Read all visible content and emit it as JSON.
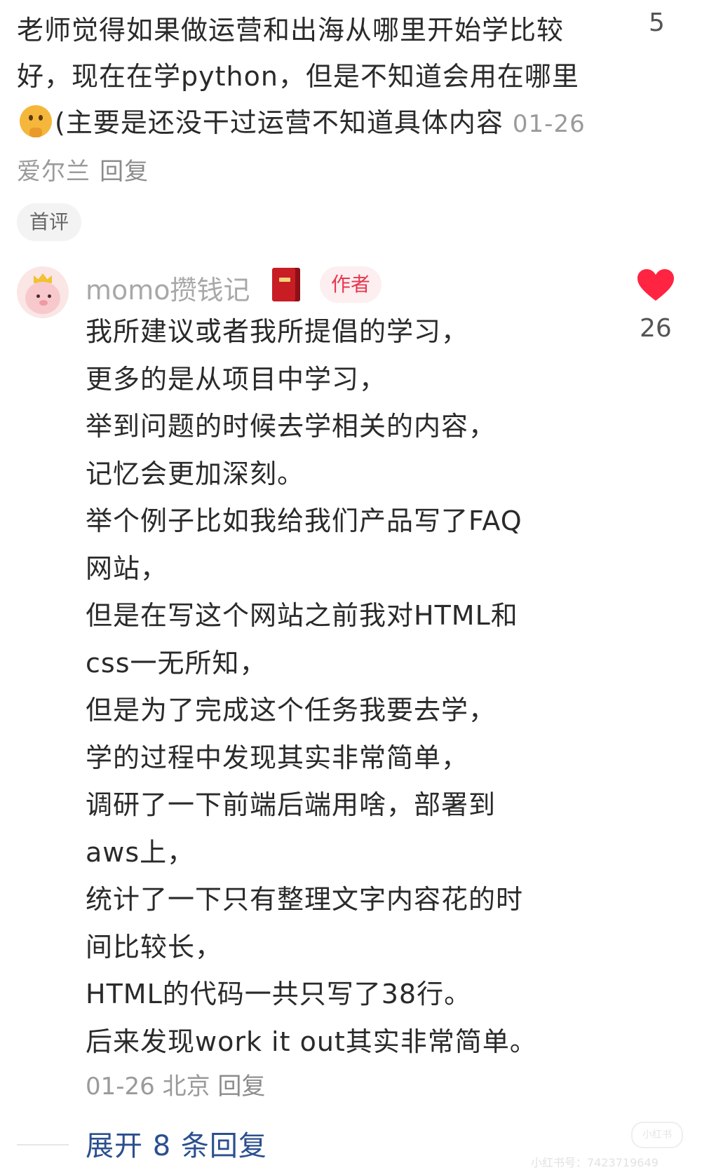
{
  "top_comment": {
    "text": "老师觉得如果做运营和出海从哪里开始学比较好，现在在学python，但是不知道会用在哪里",
    "emoji": "thinking-face-emoji",
    "text_after_emoji": "(主要是还没干过运营不知道具体内容",
    "date": "01-26",
    "location": "爱尔兰",
    "reply_label": "回复",
    "like_count": "5",
    "badge": "首评"
  },
  "reply": {
    "author_name": "momo攒钱记",
    "name_icon": "red-book-icon",
    "author_tag": "作者",
    "like_count": "26",
    "heart_color": "#ff2442",
    "lines": [
      "我所建议或者我所提倡的学习，",
      "更多的是从项目中学习，",
      "举到问题的时候去学相关的内容，",
      "记忆会更加深刻。",
      "举个例子比如我给我们产品写了FAQ",
      "网站，",
      "但是在写这个网站之前我对HTML和",
      "css一无所知，",
      "但是为了完成这个任务我要去学，",
      "学的过程中发现其实非常简单，",
      "调研了一下前端后端用啥，部署到",
      "aws上，",
      "统计了一下只有整理文字内容花的时",
      "间比较长，",
      "HTML的代码一共只写了38行。",
      "后来发现work it out其实非常简单。"
    ],
    "date": "01-26",
    "location": "北京",
    "reply_label": "回复"
  },
  "expand_label": "展开 8 条回复",
  "watermark": {
    "logo_text": "小红书",
    "id_text": "小红书号：7423719649"
  }
}
